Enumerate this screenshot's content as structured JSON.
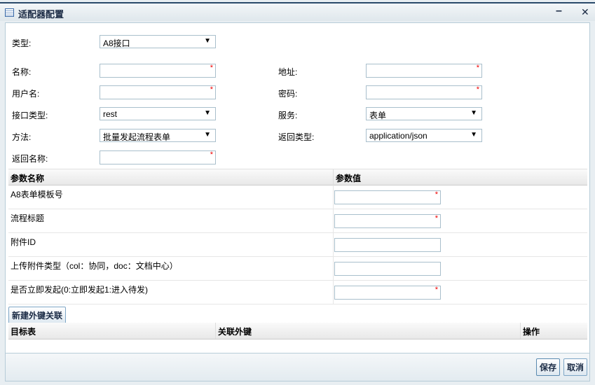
{
  "window": {
    "title": "适配器配置",
    "minimize": "–",
    "close": "✕"
  },
  "form": {
    "type_label": "类型:",
    "type_value": "A8接口",
    "name_label": "名称:",
    "address_label": "地址:",
    "username_label": "用户名:",
    "password_label": "密码:",
    "iface_type_label": "接口类型:",
    "iface_type_value": "rest",
    "service_label": "服务:",
    "service_value": "表单",
    "method_label": "方法:",
    "method_value": "批量发起流程表单",
    "return_type_label": "返回类型:",
    "return_type_value": "application/json",
    "return_name_label": "返回名称:",
    "required_mark": "*",
    "dropdown_arrow": "▼"
  },
  "params": {
    "headers": [
      "参数名称",
      "参数值"
    ],
    "rows": [
      {
        "name": "A8表单模板号",
        "required": "*"
      },
      {
        "name": "流程标题",
        "required": "*"
      },
      {
        "name": "附件ID",
        "required": ""
      },
      {
        "name": "上传附件类型（col：协同，doc：文档中心）",
        "required": ""
      },
      {
        "name": "是否立即发起(0:立即发起1:进入待发)",
        "required": "*"
      }
    ]
  },
  "fk": {
    "new_button": "新建外键关联",
    "headers": [
      "目标表",
      "关联外键",
      "操作"
    ]
  },
  "footer": {
    "save": "保存",
    "cancel": "取消"
  }
}
